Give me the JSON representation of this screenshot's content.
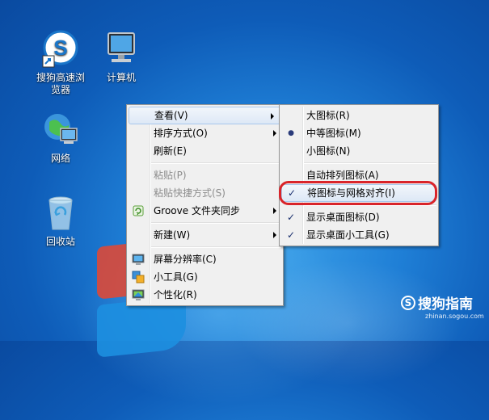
{
  "desktop": {
    "icons": [
      {
        "label_line1": "搜狗高速浏",
        "label_line2": "览器"
      },
      {
        "label_line1": "计算机"
      },
      {
        "label_line1": "网络"
      },
      {
        "label_line1": "回收站"
      }
    ]
  },
  "context_menu": {
    "items": {
      "view": "查看(V)",
      "sort": "排序方式(O)",
      "refresh": "刷新(E)",
      "paste": "粘贴(P)",
      "paste_shortcut": "粘贴快捷方式(S)",
      "groove": "Groove 文件夹同步",
      "new": "新建(W)",
      "screen_resolution": "屏幕分辨率(C)",
      "gadgets": "小工具(G)",
      "personalize": "个性化(R)"
    }
  },
  "view_submenu": {
    "items": {
      "large_icons": "大图标(R)",
      "medium_icons": "中等图标(M)",
      "small_icons": "小图标(N)",
      "auto_arrange": "自动排列图标(A)",
      "align_to_grid": "将图标与网格对齐(I)",
      "show_desktop_icons": "显示桌面图标(D)",
      "show_gadgets": "显示桌面小工具(G)"
    },
    "check_glyph": "✓",
    "radio_glyph": "●"
  },
  "watermark": {
    "brand": "搜狗指南",
    "logo_letter": "S",
    "site": "zhinan.sogou.com"
  },
  "colors": {
    "highlight_border": "#d9242a",
    "menu_bg": "#f0f0f0",
    "desktop_blue": "#1f7fd6"
  }
}
